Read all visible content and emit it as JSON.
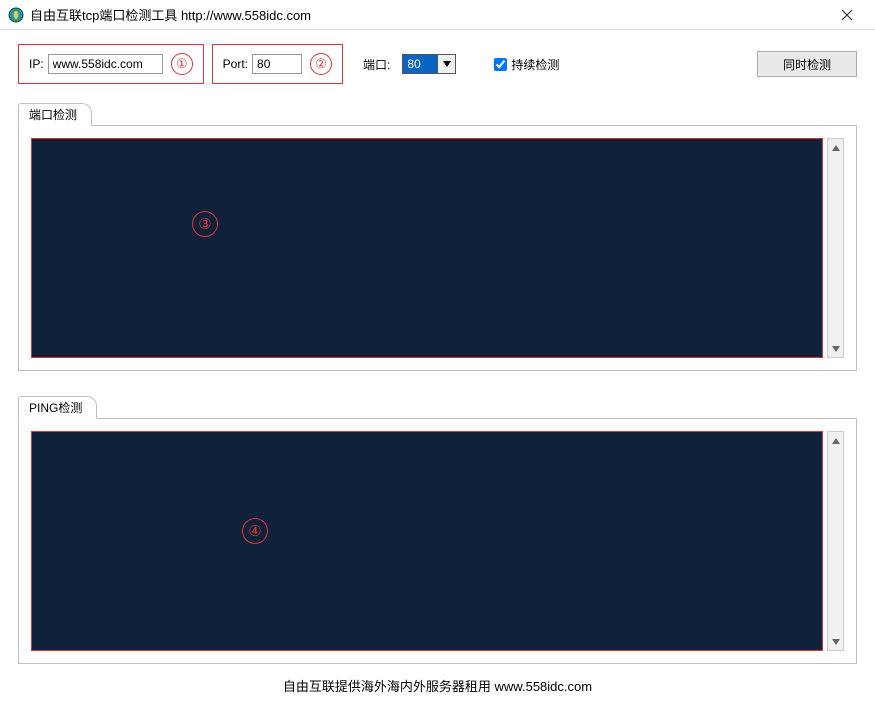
{
  "window": {
    "title": "自由互联tcp端口检测工具 http://www.558idc.com"
  },
  "inputs": {
    "ip_label": "IP:",
    "ip_value": "www.558idc.com",
    "port_label": "Port:",
    "port_value": "80",
    "port_label2": "端口:",
    "port_select": "80",
    "continuous_label": "持续检测",
    "continuous_checked": true,
    "run_button": "同时检测"
  },
  "annotations": {
    "one": "①",
    "two": "②",
    "three": "③",
    "four": "④"
  },
  "panels": {
    "port_tab": "端口检测",
    "ping_tab": "PING检测"
  },
  "footer": "自由互联提供海外海内外服务器租用 www.558idc.com"
}
